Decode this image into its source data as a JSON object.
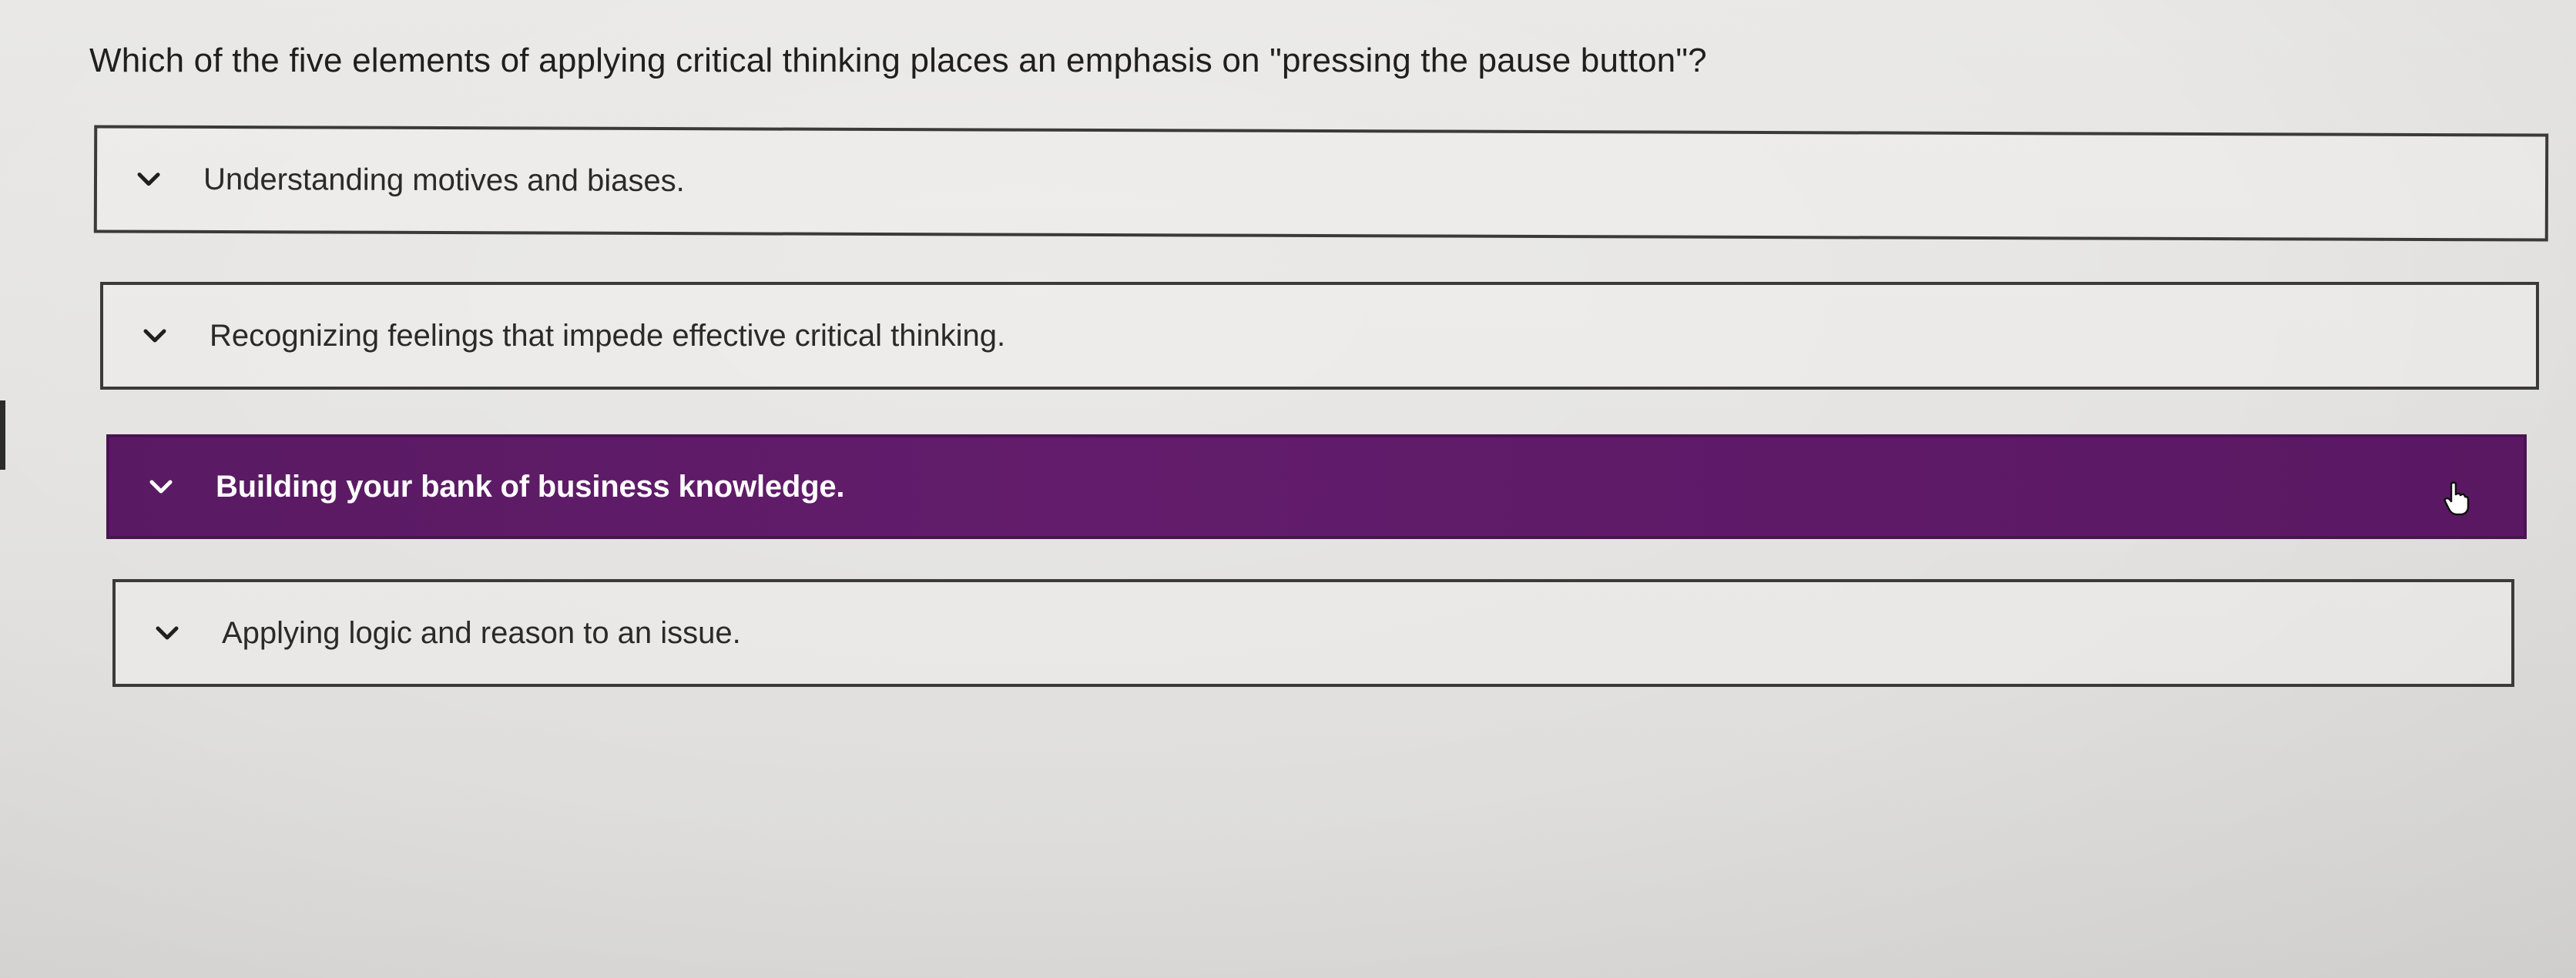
{
  "question": {
    "text": "Which of the five elements of applying critical thinking places an emphasis on \"pressing the pause button\"?"
  },
  "options": [
    {
      "label": "Understanding motives and biases.",
      "selected": false,
      "icon": "chevron-down-icon"
    },
    {
      "label": "Recognizing feelings that impede effective critical thinking.",
      "selected": false,
      "icon": "chevron-down-icon"
    },
    {
      "label": "Building your bank of business knowledge.",
      "selected": true,
      "icon": "chevron-down-icon"
    },
    {
      "label": "Applying logic and reason to an issue.",
      "selected": false,
      "icon": "chevron-down-icon"
    }
  ],
  "colors": {
    "selected_background": "#5e1b67",
    "selected_text": "#ffffff",
    "border": "#3a3a3a",
    "page_background": "#e6e5e3"
  },
  "cursor": {
    "icon": "hand-pointer-icon"
  }
}
